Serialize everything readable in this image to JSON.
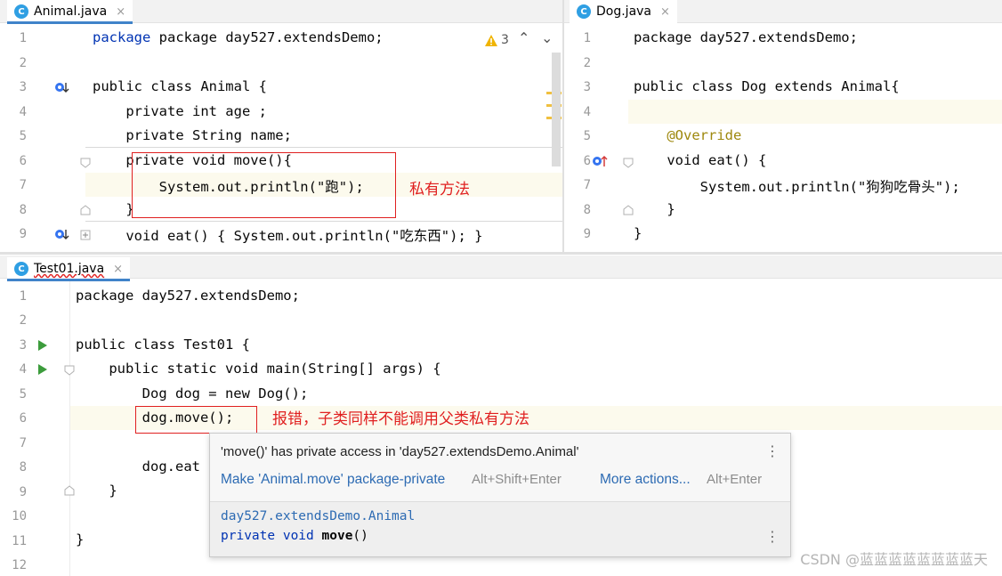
{
  "tabs": {
    "animal": "Animal.java",
    "dog": "Dog.java",
    "test": "Test01.java",
    "file_icon": "c-class-icon",
    "close_icon": "×"
  },
  "animal_editor": {
    "line_numbers": [
      "1",
      "2",
      "3",
      "4",
      "5",
      "6",
      "7",
      "8",
      "9"
    ],
    "warning_count": "3",
    "lines": [
      "package day527.extendsDemo;",
      "",
      "public class Animal {",
      "    private int age ;",
      "    private String name;",
      "    private void move(){",
      "        System.out.println(\"跑\");",
      "    }",
      "    void eat() { System.out.println(\"吃东西\"); }"
    ],
    "annotation": "私有方法"
  },
  "dog_editor": {
    "line_numbers": [
      "1",
      "2",
      "3",
      "4",
      "5",
      "6",
      "7",
      "8",
      "9"
    ],
    "lines": [
      "package day527.extendsDemo;",
      "",
      "public class Dog extends Animal{",
      "",
      "    @Override",
      "    void eat() {",
      "        System.out.println(\"狗狗吃骨头\");",
      "    }",
      "}"
    ]
  },
  "test_editor": {
    "line_numbers": [
      "1",
      "2",
      "3",
      "4",
      "5",
      "6",
      "7",
      "8",
      "9",
      "10",
      "11",
      "12"
    ],
    "lines": [
      "package day527.extendsDemo;",
      "",
      "public class Test01 {",
      "    public static void main(String[] args) {",
      "        Dog dog = new Dog();",
      "        dog.move();",
      "",
      "        dog.eat",
      "    }",
      "",
      "}",
      ""
    ],
    "annotation": "报错，子类同样不能调用父类私有方法"
  },
  "popup": {
    "message": "'move()' has private access in 'day527.extendsDemo.Animal'",
    "action_primary": "Make 'Animal.move' package-private",
    "action_primary_shortcut": "Alt+Shift+Enter",
    "action_more": "More actions...",
    "action_more_shortcut": "Alt+Enter",
    "doc_class": "day527.extendsDemo.Animal",
    "doc_signature_prefix": "private void ",
    "doc_signature_name": "move",
    "doc_signature_suffix": "()"
  },
  "watermark": "CSDN @蓝蓝蓝蓝蓝蓝蓝蓝天",
  "colors": {
    "keyword": "#0033b3",
    "string": "#067d17",
    "static_field": "#871094",
    "annotation": "#9e880d",
    "error_box": "#e02020",
    "link": "#2d6bb3"
  }
}
